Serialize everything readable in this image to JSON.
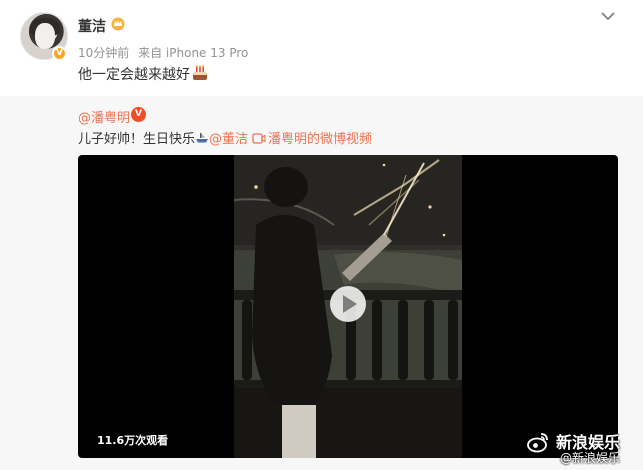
{
  "post": {
    "author": "董洁",
    "time": "10分钟前",
    "source": "来自 iPhone 13 Pro",
    "text": "他一定会越来越好"
  },
  "repost": {
    "author": "@潘粤明",
    "text_prefix": "儿子好帅！生日快乐",
    "mention": "@董洁",
    "video_link": "潘粤明的微博视频",
    "video": {
      "views": "11.6万次观看"
    }
  },
  "watermark": {
    "brand": "新浪娱乐",
    "handle": "@新浪娱乐"
  },
  "colors": {
    "link": "#eb7350",
    "meta": "#939393",
    "repost_bg": "#f7f7f7",
    "badge_gold": "#f5a623",
    "badge_red": "#f34b2a"
  },
  "icons": [
    "crown-icon",
    "cake-icon",
    "chevron-down-icon",
    "verified-icon",
    "video-icon",
    "play-icon",
    "weibo-logo-icon",
    "ship-icon"
  ]
}
